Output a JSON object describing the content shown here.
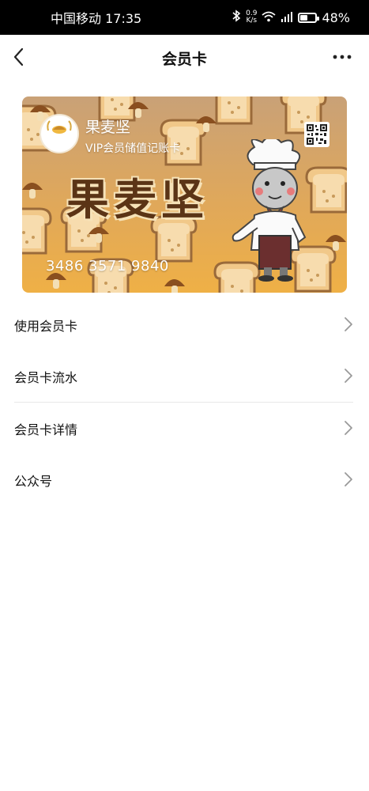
{
  "status_bar": {
    "carrier_time": "中国移动 17:35",
    "net_speed_value": "0.9",
    "net_speed_unit": "K/s",
    "battery": "48%",
    "battery_level": 0.48
  },
  "nav": {
    "title": "会员卡"
  },
  "card": {
    "brand_name": "果麦坚",
    "card_type": "VIP会员储值记账卡",
    "big_brand": "果麦坚",
    "card_number": "3486 3571 9840",
    "logo_text": "果麦坚"
  },
  "menu": {
    "items": [
      {
        "label": "使用会员卡"
      },
      {
        "label": "会员卡流水"
      },
      {
        "label": "会员卡详情"
      },
      {
        "label": "公众号"
      }
    ]
  },
  "colors": {
    "card_bg": "#e0a85a",
    "brand_text": "#5b3416",
    "divider": "#e8e8e8"
  }
}
